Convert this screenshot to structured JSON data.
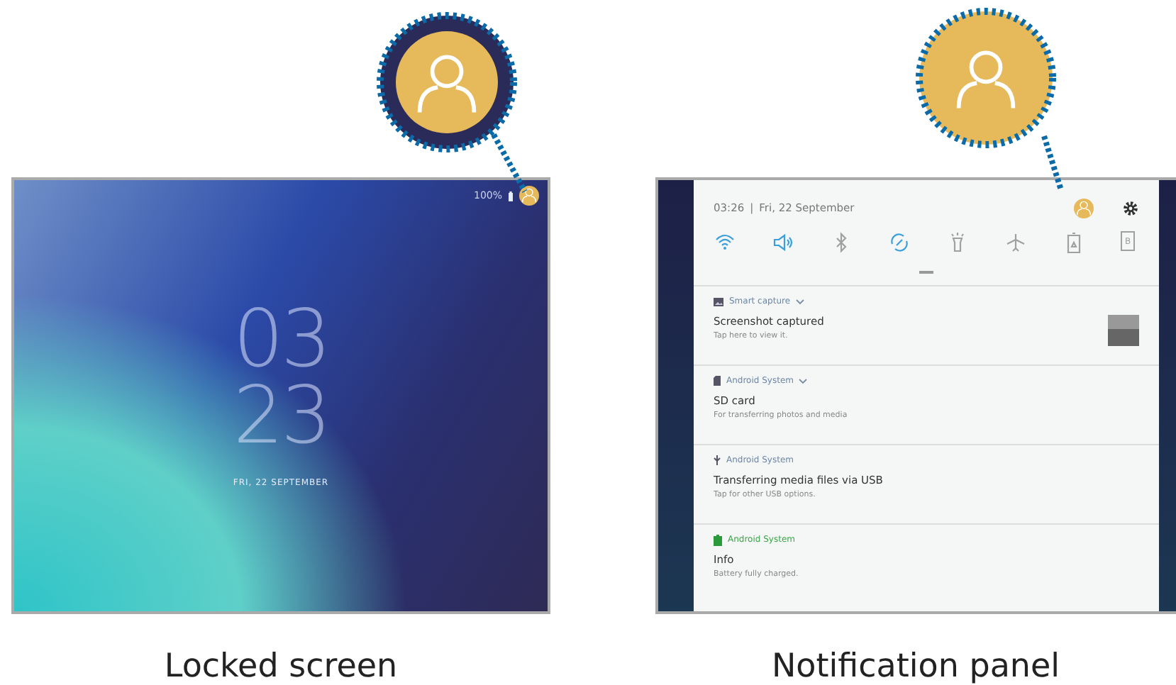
{
  "locked_screen": {
    "battery": "100%",
    "clock_hour": "03",
    "clock_minute": "23",
    "date": "FRI, 22 SEPTEMBER",
    "caption": "Locked screen"
  },
  "notification_panel": {
    "time": "03:26",
    "separator": "|",
    "date": "Fri, 22 September",
    "quick_settings": [
      {
        "kind": "wifi",
        "on": true
      },
      {
        "kind": "sound",
        "on": true
      },
      {
        "kind": "bluetooth",
        "on": false
      },
      {
        "kind": "rotate",
        "on": true
      },
      {
        "kind": "flashlight",
        "on": false
      },
      {
        "kind": "airplane",
        "on": false
      },
      {
        "kind": "power-saving",
        "on": false
      },
      {
        "kind": "reading-mode",
        "on": false,
        "label": "B"
      }
    ],
    "notifications": [
      {
        "kind": "image",
        "app": "Smart capture",
        "color": "#6b87a8",
        "expandable": true,
        "title": "Screenshot captured",
        "text": "Tap here to view it.",
        "thumbnail": true
      },
      {
        "kind": "sd-card",
        "app": "Android System",
        "color": "#6b87a8",
        "expandable": true,
        "title": "SD card",
        "text": "For transferring photos and media",
        "thumbnail": false
      },
      {
        "kind": "usb",
        "app": "Android System",
        "color": "#6b87a8",
        "expandable": false,
        "title": "Transferring media files via USB",
        "text": "Tap for other USB options.",
        "thumbnail": false
      },
      {
        "kind": "battery",
        "app": "Android System",
        "color": "#3aa548",
        "expandable": false,
        "title": "Info",
        "text": "Battery fully charged.",
        "thumbnail": false
      }
    ],
    "caption": "Notification panel"
  }
}
